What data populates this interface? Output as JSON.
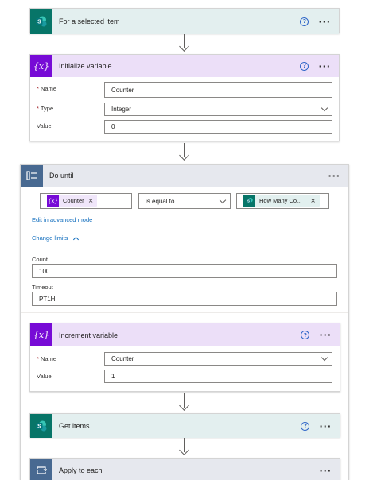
{
  "trigger": {
    "title": "For a selected item",
    "icon": "sharepoint-icon"
  },
  "init_variable": {
    "title": "Initialize variable",
    "icon": "variable-icon",
    "name_label": "Name",
    "name_value": "Counter",
    "type_label": "Type",
    "type_value": "Integer",
    "value_label": "Value",
    "value_value": "0"
  },
  "do_until": {
    "title": "Do until",
    "icon": "loop-icon",
    "condition": {
      "left_token": "Counter",
      "operator": "is equal to",
      "right_token": "How Many Co..."
    },
    "advanced_link": "Edit in advanced mode",
    "change_limits": "Change limits",
    "count_label": "Count",
    "count_value": "100",
    "timeout_label": "Timeout",
    "timeout_value": "PT1H",
    "increment": {
      "title": "Increment variable",
      "name_label": "Name",
      "name_value": "Counter",
      "value_label": "Value",
      "value_value": "1"
    }
  },
  "get_items": {
    "title": "Get items",
    "icon": "sharepoint-icon"
  },
  "apply_to_each": {
    "title": "Apply to each",
    "icon": "loop-icon"
  },
  "symbols": {
    "help": "?",
    "more": "···",
    "required": "*",
    "remove": "×"
  },
  "colors": {
    "sharepoint": "#077568",
    "variable": "#770bd6",
    "control": "#486991",
    "link": "#0f6cbd"
  }
}
